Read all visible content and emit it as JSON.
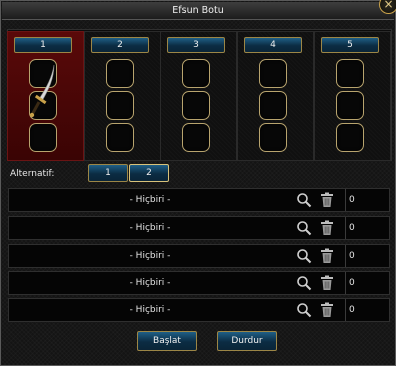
{
  "window": {
    "title": "Efsun Botu",
    "close_glyph": "×"
  },
  "tabs": [
    {
      "label": "1",
      "active": true
    },
    {
      "label": "2",
      "active": false
    },
    {
      "label": "3",
      "active": false
    },
    {
      "label": "4",
      "active": false
    },
    {
      "label": "5",
      "active": false
    }
  ],
  "alternatives": {
    "label": "Alternatif:",
    "options": [
      "1",
      "2"
    ],
    "selected": "2"
  },
  "rows": [
    {
      "name": "- Hiçbiri -",
      "count": "0"
    },
    {
      "name": "- Hiçbiri -",
      "count": "0"
    },
    {
      "name": "- Hiçbiri -",
      "count": "0"
    },
    {
      "name": "- Hiçbiri -",
      "count": "0"
    },
    {
      "name": "- Hiçbiri -",
      "count": "0"
    }
  ],
  "buttons": {
    "start": "Başlat",
    "stop": "Durdur"
  },
  "icons": {
    "search": "search-icon",
    "delete": "trash-icon",
    "item": "sword-icon"
  },
  "colors": {
    "accent_gold": "#b8a46e",
    "active_red": "#4a0606",
    "button_blue": "#0b2c43"
  }
}
